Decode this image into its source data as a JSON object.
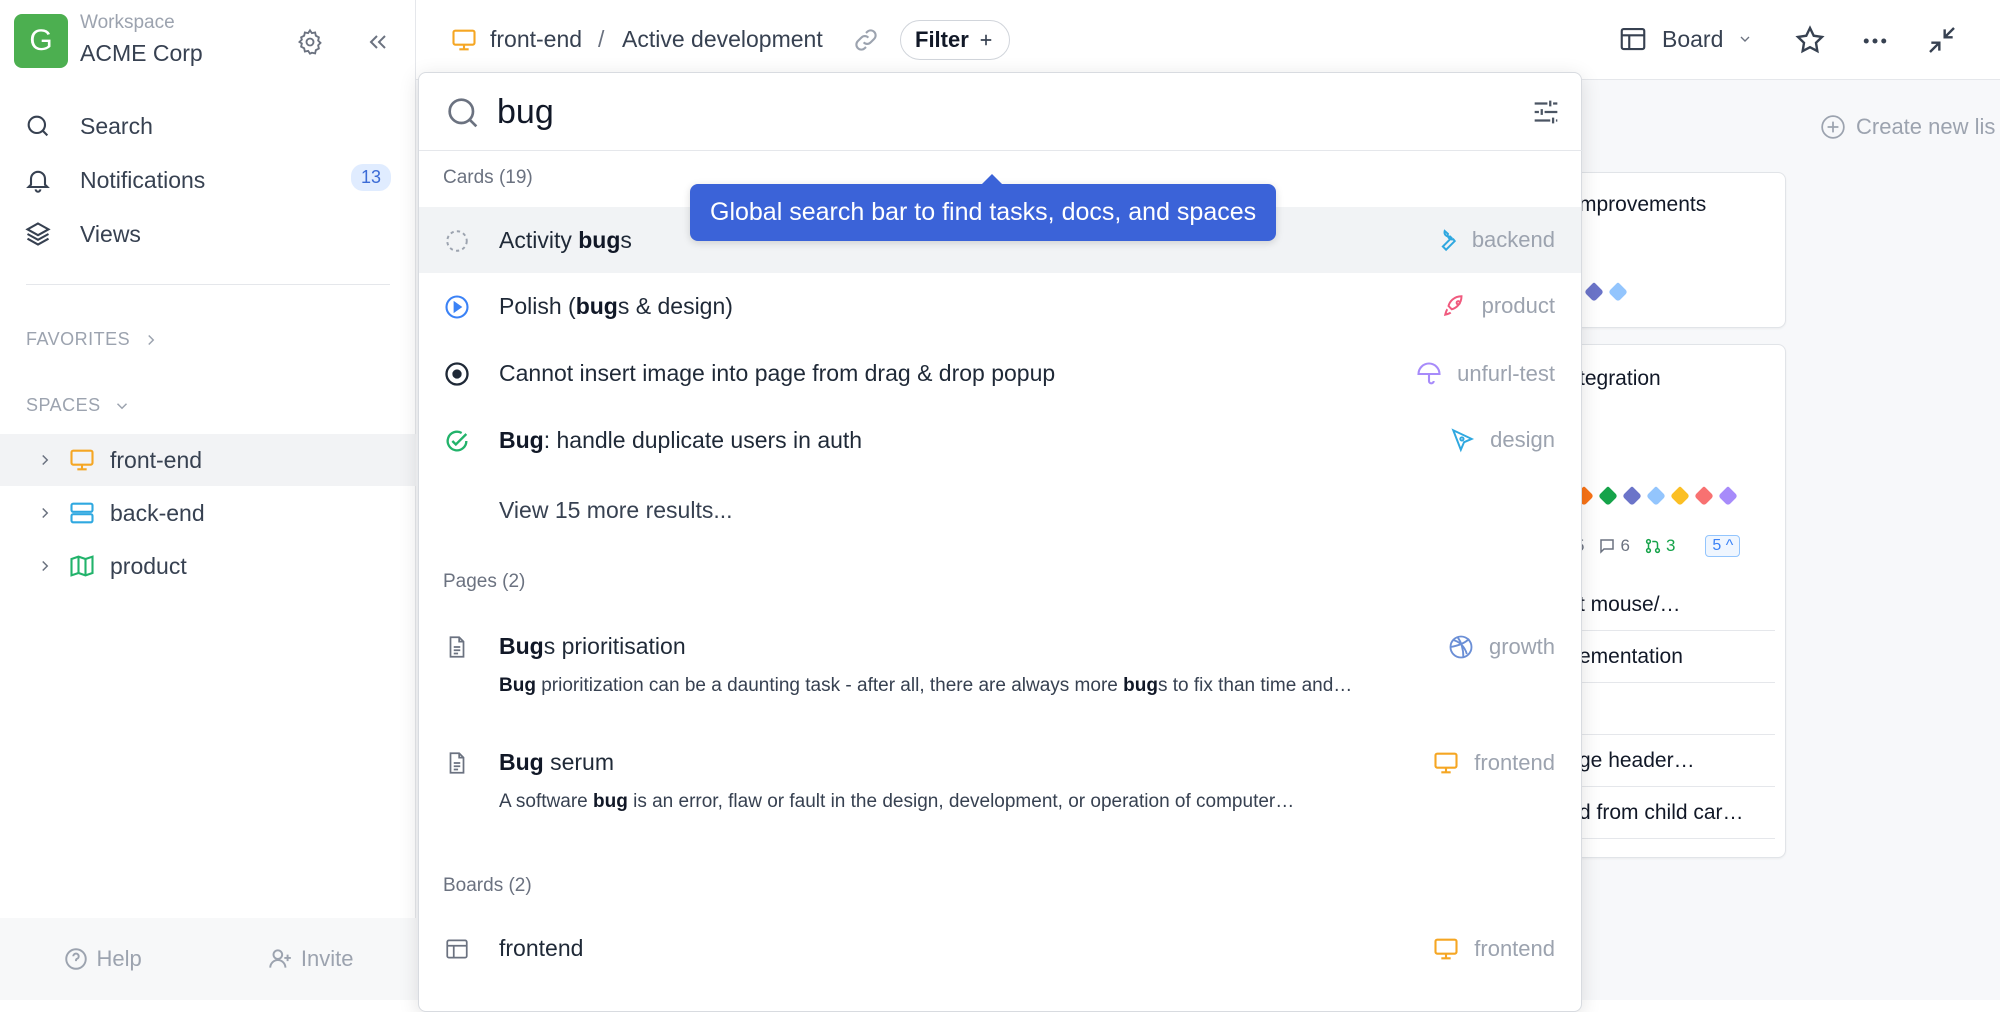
{
  "sidebar": {
    "workspace_initial": "G",
    "workspace_label": "Workspace",
    "workspace_name": "ACME Corp",
    "nav": [
      {
        "label": "Search",
        "icon": "search-icon"
      },
      {
        "label": "Notifications",
        "icon": "bell-icon",
        "badge": "13"
      },
      {
        "label": "Views",
        "icon": "layers-icon"
      }
    ],
    "favorites_label": "FAVORITES",
    "spaces_label": "SPACES",
    "spaces": [
      {
        "label": "front-end",
        "icon": "monitor-icon",
        "color": "#f5a623",
        "active": true
      },
      {
        "label": "back-end",
        "icon": "server-icon",
        "color": "#2fa8e0"
      },
      {
        "label": "product",
        "icon": "map-icon",
        "color": "#22b36b"
      }
    ],
    "help_label": "Help",
    "invite_label": "Invite"
  },
  "topbar": {
    "space": "front-end",
    "separator": "/",
    "board": "Active development",
    "filter_label": "Filter",
    "view_label": "Board"
  },
  "background_board": {
    "create_list": "Create new lis",
    "card1_title": "mprovements",
    "card2_title": "tegration",
    "card2_meta": {
      "count_a": "5",
      "comments": "6",
      "pulls": "3",
      "chip": "5"
    },
    "card2_items": [
      "t mouse/…",
      "ementation",
      "",
      "ge header…",
      "d from child car…"
    ]
  },
  "search": {
    "query": "bug",
    "groups": {
      "cards": "Cards (19)",
      "pages": "Pages (2)",
      "boards": "Boards (2)"
    },
    "card_results": [
      {
        "pre": "Activity ",
        "bold": "bug",
        "post": "s",
        "space": "backend",
        "space_color": "#2fa8e0"
      },
      {
        "pre": "Polish (",
        "bold": "bug",
        "post": "s & design)",
        "space": "product",
        "space_color": "#f05a7e"
      },
      {
        "pre": "",
        "bold": "",
        "post": "Cannot insert image into page from drag & drop popup",
        "space": "unfurl-test",
        "space_color": "#a78bfa"
      },
      {
        "pre": "",
        "bold": "Bug",
        "post": ": handle duplicate users in auth",
        "space": "design",
        "space_color": "#2fa8e0"
      }
    ],
    "more_label": "View 15 more results...",
    "page_results": [
      {
        "bold": "Bug",
        "post": "s prioritisation",
        "space": "growth",
        "space_color": "#6b8fd6",
        "desc_b1": "Bug",
        "desc_m": " prioritization can be a daunting task - after all, there are always more ",
        "desc_b2": "bug",
        "desc_e": "s to fix than time and…"
      },
      {
        "bold": "Bug",
        "post": " serum",
        "space": "frontend",
        "space_color": "#f5a623",
        "desc_pre": "A software ",
        "desc_b": "bug",
        "desc_e": " is an error, flaw or fault in the design, development, or operation of computer…"
      }
    ],
    "board_results": [
      {
        "label": "frontend",
        "space": "frontend",
        "space_color": "#f5a623"
      }
    ]
  },
  "tooltip": "Global search bar to find tasks, docs, and spaces"
}
